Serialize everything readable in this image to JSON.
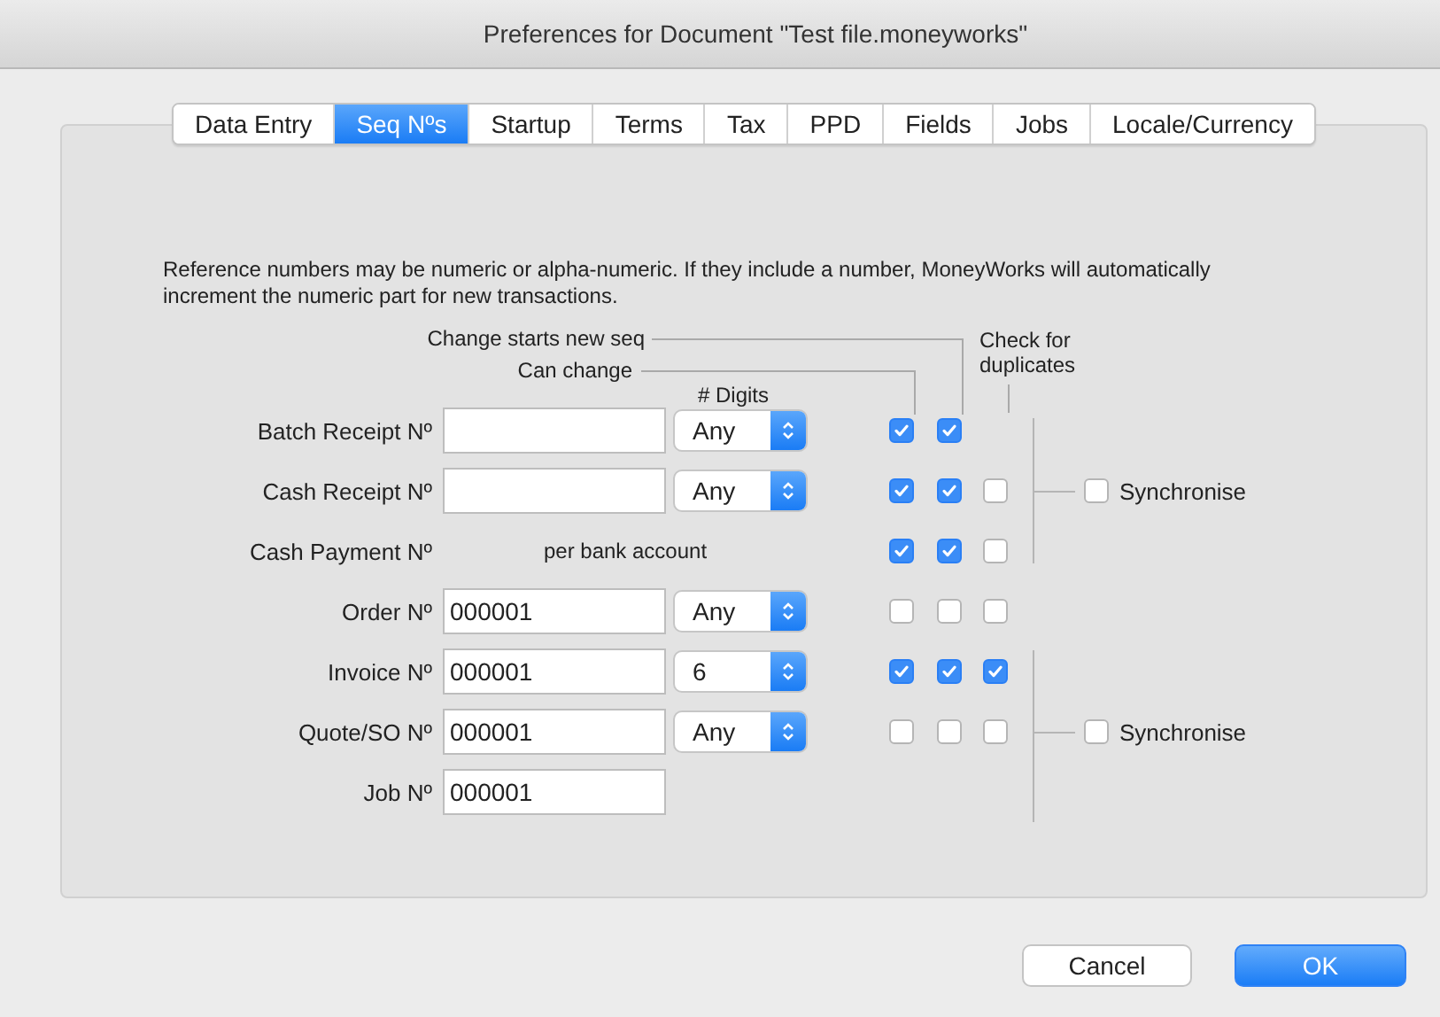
{
  "window": {
    "title": "Preferences for Document \"Test file.moneyworks\""
  },
  "tabs": [
    {
      "label": "Data Entry",
      "selected": false
    },
    {
      "label": "Seq Nºs",
      "selected": true
    },
    {
      "label": "Startup",
      "selected": false
    },
    {
      "label": "Terms",
      "selected": false
    },
    {
      "label": "Tax",
      "selected": false
    },
    {
      "label": "PPD",
      "selected": false
    },
    {
      "label": "Fields",
      "selected": false
    },
    {
      "label": "Jobs",
      "selected": false
    },
    {
      "label": "Locale/Currency",
      "selected": false
    }
  ],
  "description": "Reference numbers may be numeric or alpha-numeric. If they include a number, MoneyWorks will automatically increment the numeric part for new transactions.",
  "headers": {
    "starts_new": "Change starts new seq",
    "can_change": "Can change",
    "check_duplicates": "Check for duplicates",
    "digits": "# Digits"
  },
  "rows": [
    {
      "label": "Batch Receipt Nº",
      "kind": "field",
      "value": "",
      "digits": "Any",
      "checks": [
        {
          "checked": true
        },
        {
          "checked": true
        }
      ]
    },
    {
      "label": "Cash Receipt Nº",
      "kind": "field",
      "value": "",
      "digits": "Any",
      "checks": [
        {
          "checked": true
        },
        {
          "checked": true
        },
        {
          "checked": false
        }
      ]
    },
    {
      "label": "Cash Payment Nº",
      "kind": "text",
      "note": "per bank account",
      "checks": [
        {
          "checked": true
        },
        {
          "checked": true
        },
        {
          "checked": false
        }
      ]
    },
    {
      "label": "Order Nº",
      "kind": "field",
      "value": "000001",
      "digits": "Any",
      "checks": [
        {
          "checked": false
        },
        {
          "checked": false
        },
        {
          "checked": false
        }
      ]
    },
    {
      "label": "Invoice Nº",
      "kind": "field",
      "value": "000001",
      "digits": "6",
      "checks": [
        {
          "checked": true
        },
        {
          "checked": true
        },
        {
          "checked": true
        }
      ]
    },
    {
      "label": "Quote/SO Nº",
      "kind": "field",
      "value": "000001",
      "digits": "Any",
      "checks": [
        {
          "checked": false
        },
        {
          "checked": false
        },
        {
          "checked": false
        }
      ]
    },
    {
      "label": "Job Nº",
      "kind": "field",
      "value": "000001"
    }
  ],
  "synchronise": [
    {
      "label": "Synchronise",
      "checked": false
    },
    {
      "label": "Synchronise",
      "checked": false
    }
  ],
  "buttons": [
    {
      "label": "Cancel",
      "kind": "secondary"
    },
    {
      "label": "OK",
      "kind": "primary"
    }
  ]
}
